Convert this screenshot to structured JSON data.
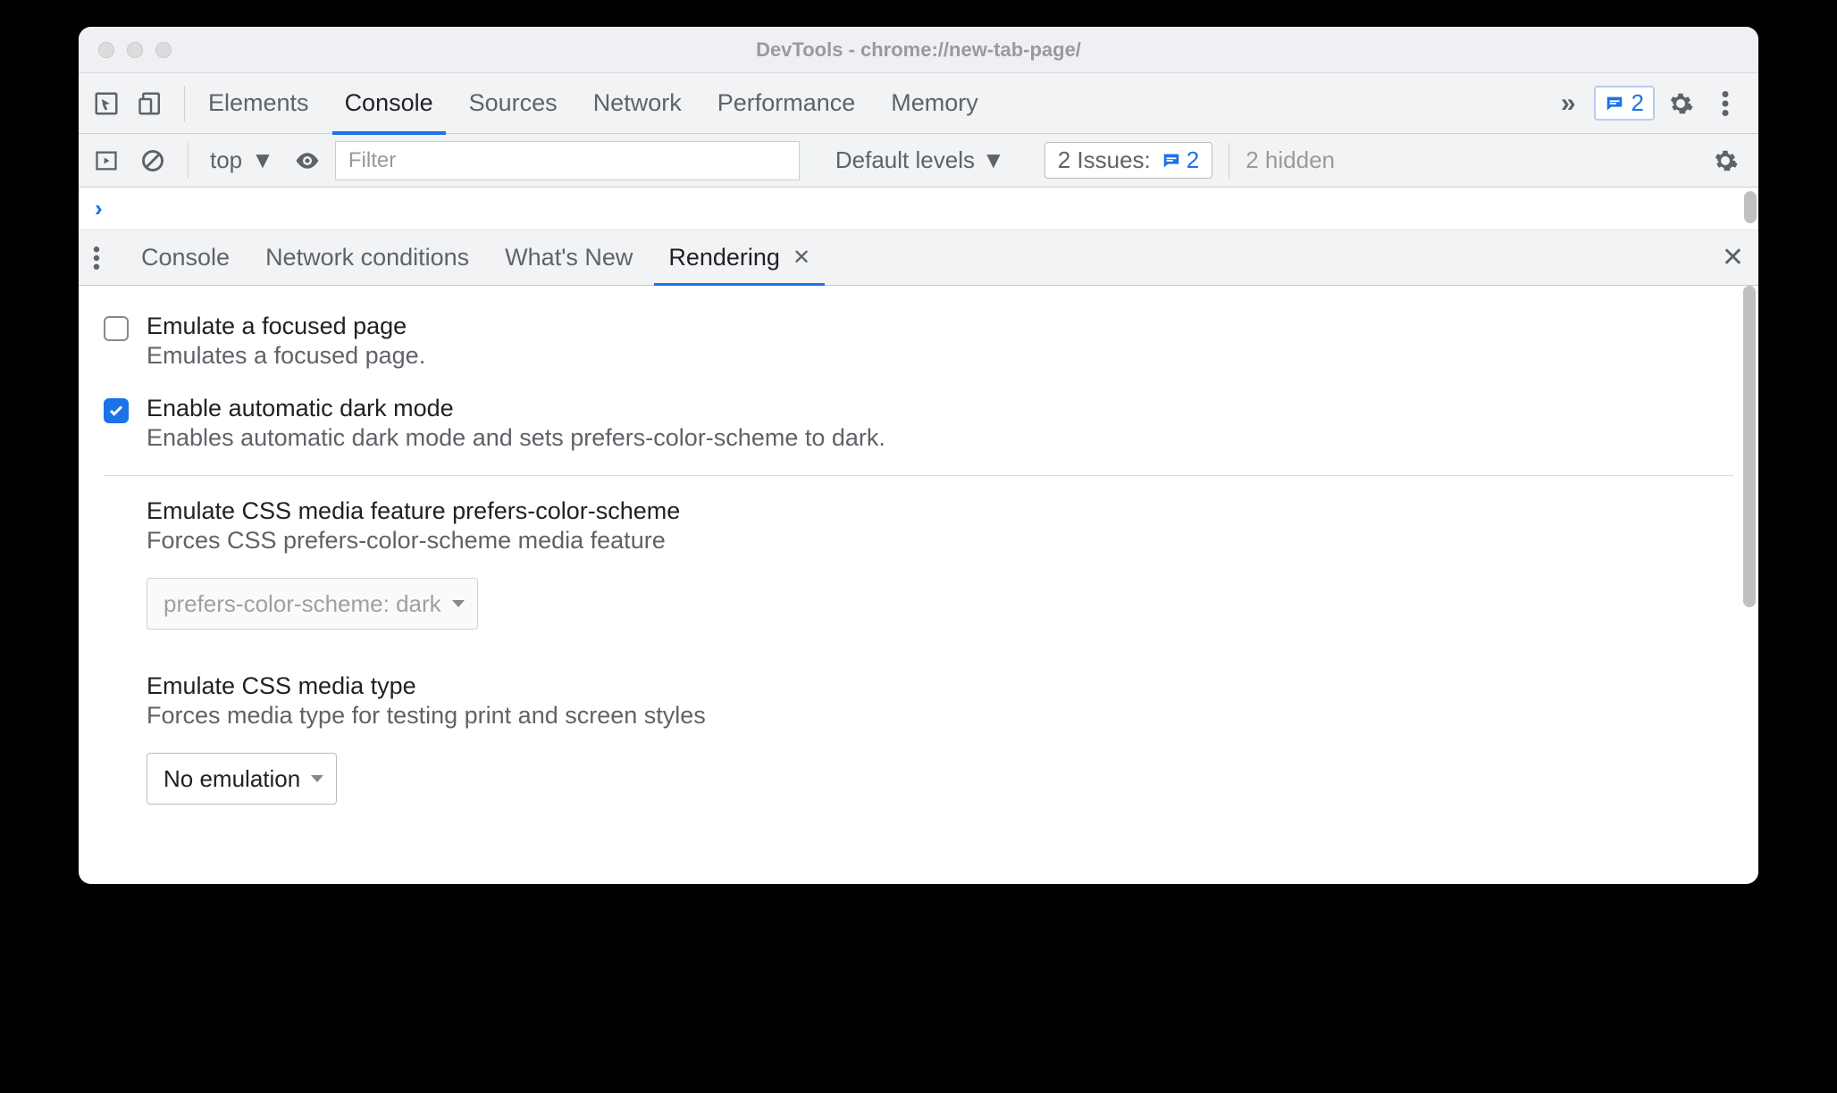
{
  "window": {
    "title": "DevTools - chrome://new-tab-page/"
  },
  "main_tabs": {
    "items": [
      "Elements",
      "Console",
      "Sources",
      "Network",
      "Performance",
      "Memory"
    ],
    "active_index": 1
  },
  "badge": {
    "count": "2"
  },
  "console_bar": {
    "context": "top",
    "filter_placeholder": "Filter",
    "levels_label": "Default levels",
    "issues_label": "2 Issues:",
    "issues_count": "2",
    "hidden_label": "2 hidden"
  },
  "drawer": {
    "tabs": [
      "Console",
      "Network conditions",
      "What's New",
      "Rendering"
    ],
    "active_index": 3
  },
  "rendering": {
    "opt1": {
      "title": "Emulate a focused page",
      "desc": "Emulates a focused page.",
      "checked": false
    },
    "opt2": {
      "title": "Enable automatic dark mode",
      "desc": "Enables automatic dark mode and sets prefers-color-scheme to dark.",
      "checked": true
    },
    "sec1": {
      "title": "Emulate CSS media feature prefers-color-scheme",
      "desc": "Forces CSS prefers-color-scheme media feature",
      "select": "prefers-color-scheme: dark"
    },
    "sec2": {
      "title": "Emulate CSS media type",
      "desc": "Forces media type for testing print and screen styles",
      "select": "No emulation"
    }
  }
}
